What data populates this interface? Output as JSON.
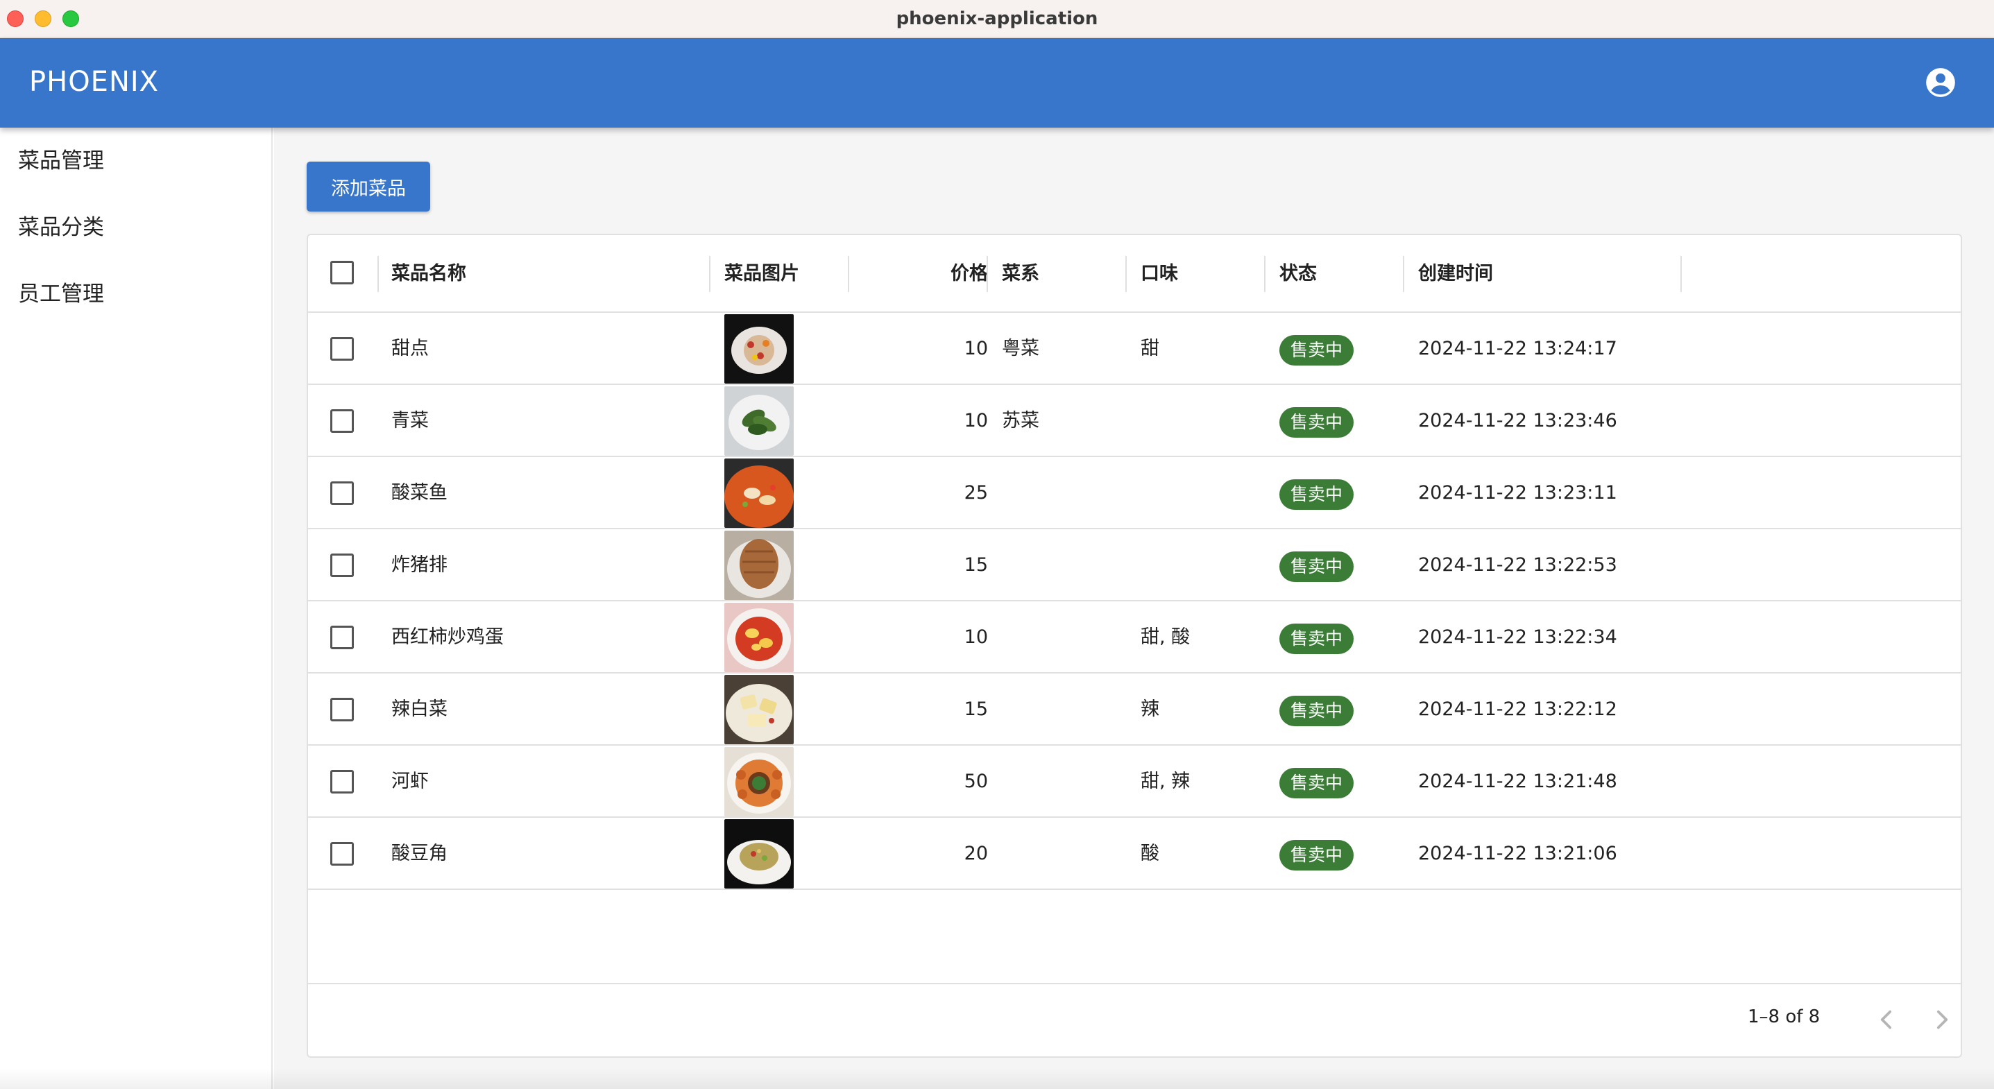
{
  "window": {
    "title": "phoenix-application"
  },
  "appbar": {
    "brand": "PHOENIX",
    "account_icon": "account-circle-icon"
  },
  "sidebar": {
    "items": [
      {
        "label": "菜品管理"
      },
      {
        "label": "菜品分类"
      },
      {
        "label": "员工管理"
      }
    ]
  },
  "toolbar": {
    "add_label": "添加菜品"
  },
  "table": {
    "columns": {
      "name": "菜品名称",
      "image": "菜品图片",
      "price": "价格",
      "cuisine": "菜系",
      "flavor": "口味",
      "status": "状态",
      "created": "创建时间"
    },
    "rows": [
      {
        "name": "甜点",
        "image_icon": "dessert-photo",
        "price": "10",
        "cuisine": "粤菜",
        "flavor": "甜",
        "status": "售卖中",
        "created": "2024-11-22 13:24:17"
      },
      {
        "name": "青菜",
        "image_icon": "greens-photo",
        "price": "10",
        "cuisine": "苏菜",
        "flavor": "",
        "status": "售卖中",
        "created": "2024-11-22 13:23:46"
      },
      {
        "name": "酸菜鱼",
        "image_icon": "fish-photo",
        "price": "25",
        "cuisine": "",
        "flavor": "",
        "status": "售卖中",
        "created": "2024-11-22 13:23:11"
      },
      {
        "name": "炸猪排",
        "image_icon": "pork-cutlet-photo",
        "price": "15",
        "cuisine": "",
        "flavor": "",
        "status": "售卖中",
        "created": "2024-11-22 13:22:53"
      },
      {
        "name": "西红柿炒鸡蛋",
        "image_icon": "tomato-egg-photo",
        "price": "10",
        "cuisine": "",
        "flavor": "甜, 酸",
        "status": "售卖中",
        "created": "2024-11-22 13:22:34"
      },
      {
        "name": "辣白菜",
        "image_icon": "cabbage-photo",
        "price": "15",
        "cuisine": "",
        "flavor": "辣",
        "status": "售卖中",
        "created": "2024-11-22 13:22:12"
      },
      {
        "name": "河虾",
        "image_icon": "shrimp-photo",
        "price": "50",
        "cuisine": "",
        "flavor": "甜, 辣",
        "status": "售卖中",
        "created": "2024-11-22 13:21:48"
      },
      {
        "name": "酸豆角",
        "image_icon": "beans-photo",
        "price": "20",
        "cuisine": "",
        "flavor": "酸",
        "status": "售卖中",
        "created": "2024-11-22 13:21:06"
      }
    ]
  },
  "pagination": {
    "info": "1–8 of 8"
  },
  "colors": {
    "primary": "#3776cb",
    "status_green": "#3b7d36"
  }
}
